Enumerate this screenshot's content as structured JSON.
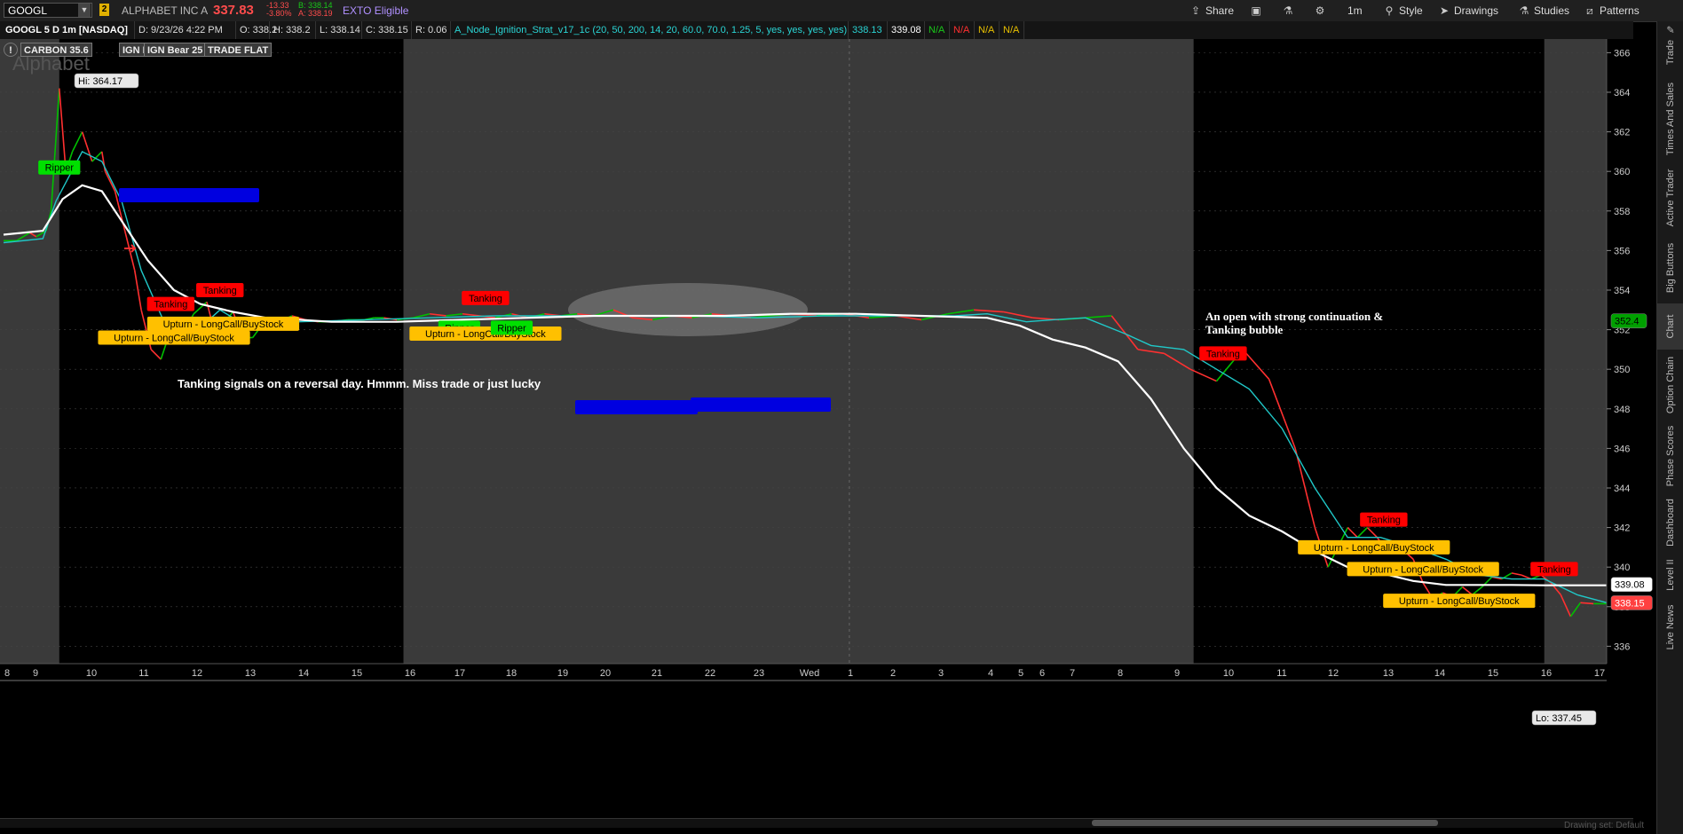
{
  "toolbar": {
    "symbol": "GOOGL",
    "link_group": "2",
    "company": "ALPHABET INC A",
    "last": "337.83",
    "net_change": "-13.33",
    "pct_change": "-3.80%",
    "bid": "B: 338.14",
    "ask": "A: 338.19",
    "exto": "EXTO Eligible",
    "buttons": {
      "share": "Share",
      "style": "Style",
      "drawings": "Drawings",
      "studies": "Studies",
      "patterns": "Patterns",
      "interval": "1m"
    }
  },
  "status": {
    "symbol_desc": "GOOGL 5 D 1m [NASDAQ]",
    "date": "D: 9/23/26 4:22 PM",
    "open": "O: 338.2",
    "high": "H: 338.2",
    "low": "L: 338.14",
    "close": "C: 338.15",
    "range": "R: 0.06",
    "study": "A_Node_Ignition_Strat_v17_1c (20, 50, 200, 14, 20, 60.0, 70.0, 1.25, 5, yes, yes, yes, yes)",
    "v1": "338.13",
    "v2": "339.08",
    "na1": "N/A",
    "na2": "N/A",
    "na3": "N/A",
    "na4": "N/A"
  },
  "indicator_badges": [
    "CARBON 35.6",
    "IGN Bull 0",
    "IGN Bear 25",
    "TRADE FLAT"
  ],
  "watermark": "Alphabet",
  "side_tabs": [
    "Trade",
    "Times And Sales",
    "Active Trader",
    "Big Buttons",
    "Chart",
    "Option Chain",
    "Phase Scores",
    "Dashboard",
    "Level II",
    "Live News"
  ],
  "drawing_set": "Drawing set: Default",
  "colors": {
    "bull": "#00c000",
    "bear": "#ff3030",
    "ma_long": "#ffffff",
    "ma_short": "#20c8c8",
    "session_bg": "#3a3a3a",
    "ext_bg": "#000000",
    "tag_tanking": "#ff0000",
    "tag_upturn": "#ffc000",
    "tag_ripper": "#00e000",
    "tag_blue": "#0000e0"
  },
  "chart_data": {
    "type": "line",
    "symbol": "GOOGL",
    "interval": "1m",
    "period": "5 D",
    "y_axis_ticks": [
      336,
      338,
      340,
      342,
      344,
      346,
      348,
      350,
      352,
      354,
      356,
      358,
      360,
      362,
      364,
      366
    ],
    "ylim": [
      335.3,
      366.6
    ],
    "x_ticks": [
      "8",
      "9",
      "10",
      "11",
      "12",
      "13",
      "14",
      "15",
      "16",
      "17",
      "18",
      "19",
      "20",
      "21",
      "22",
      "23",
      "Wed",
      "1",
      "2",
      "3",
      "4",
      "5",
      "6",
      "7",
      "8",
      "9",
      "10",
      "11",
      "12",
      "13",
      "14",
      "15",
      "16",
      "17"
    ],
    "price_labels": {
      "current": "338.15",
      "ma_value": "339.08",
      "other": "352.4",
      "high": "Hi: 364.17",
      "low": "Lo: 337.45"
    },
    "series": [
      {
        "name": "Price",
        "x": [
          0,
          4,
          8,
          10,
          13,
          14.5,
          17,
          19,
          21,
          24,
          27,
          30,
          31,
          34,
          37,
          40,
          42,
          45,
          48,
          51,
          54,
          58,
          62,
          64,
          67,
          70,
          73,
          76,
          80,
          84,
          88,
          92,
          96,
          100,
          105,
          110,
          113,
          116,
          120,
          125,
          130,
          135,
          140,
          145,
          150,
          155,
          160,
          165,
          170,
          175,
          180,
          186,
          192,
          198,
          204,
          210,
          216,
          222,
          228,
          234,
          240,
          248,
          256,
          264,
          272,
          280,
          288,
          296,
          305,
          314,
          322,
          330,
          338,
          346,
          354,
          362,
          370,
          378,
          386,
          394,
          400,
          404,
          407,
          410,
          413,
          416,
          419,
          422,
          426,
          430,
          433,
          436,
          439,
          442,
          445,
          448,
          451,
          454,
          457,
          460,
          463,
          466,
          469,
          472,
          475,
          478,
          481,
          485,
          489
        ],
        "y": [
          356.5,
          356.5,
          356.9,
          356.7,
          357,
          358,
          364.2,
          360,
          361,
          362,
          360.5,
          361,
          360,
          359,
          357,
          355,
          353,
          351,
          350.5,
          352,
          351.6,
          352.8,
          353.4,
          352.1,
          352.3,
          352.9,
          351.6,
          351.6,
          352.5,
          352.4,
          352.7,
          352.5,
          352.4,
          352.4,
          352.5,
          352.5,
          352.6,
          352.6,
          352.5,
          352.6,
          352.8,
          352.7,
          352.8,
          352.7,
          352.6,
          352.8,
          352.6,
          352.8,
          352.7,
          352.8,
          352.7,
          353,
          352.6,
          352.5,
          352.7,
          352.6,
          352.8,
          352.7,
          352.6,
          352.7,
          352.8,
          352.7,
          352.8,
          352.6,
          352.7,
          352.5,
          352.8,
          353,
          352.9,
          352.6,
          352.5,
          352.6,
          352.7,
          351,
          350.8,
          350,
          349.4,
          351,
          349.5,
          346,
          342,
          340,
          341,
          342,
          341.5,
          342,
          341.5,
          340.8,
          341,
          340.4,
          339.2,
          338.4,
          338.7,
          338.5,
          339,
          338.6,
          339,
          339.5,
          339.4,
          339.7,
          339.6,
          339.4,
          339.6,
          339.2,
          338.6,
          337.5,
          338.2,
          338.15,
          338.15
        ]
      },
      {
        "name": "EMA",
        "x": [
          0,
          12,
          16,
          24,
          30,
          36,
          42,
          50,
          58,
          66,
          74,
          90,
          110,
          130,
          150,
          170,
          190,
          210,
          230,
          250,
          270,
          290,
          300,
          306,
          312,
          320,
          330,
          342,
          350,
          360,
          370,
          380,
          390,
          400,
          410,
          420,
          430,
          440,
          450,
          460,
          470,
          480,
          489
        ],
        "y": [
          356.4,
          356.6,
          358.5,
          361,
          360.5,
          358.5,
          355,
          352,
          351.8,
          353,
          352.2,
          352.4,
          352.5,
          352.6,
          352.7,
          352.7,
          352.7,
          352.7,
          352.6,
          352.7,
          352.7,
          352.7,
          352.8,
          352.6,
          352.4,
          352.5,
          352.6,
          351.8,
          351.2,
          351,
          350,
          349,
          347,
          344,
          341.5,
          341.5,
          341,
          340.4,
          339.6,
          339.4,
          339.4,
          338.6,
          338.2
        ]
      },
      {
        "name": "MA200",
        "x": [
          0,
          12,
          18,
          24,
          30,
          36,
          44,
          52,
          60,
          70,
          80,
          90,
          100,
          120,
          140,
          160,
          180,
          200,
          220,
          240,
          260,
          280,
          300,
          310,
          320,
          330,
          340,
          350,
          360,
          370,
          380,
          390,
          400,
          410,
          420,
          430,
          440,
          450,
          460,
          470,
          480,
          489
        ],
        "y": [
          356.8,
          357,
          358.6,
          359.3,
          359,
          357.5,
          355.5,
          354,
          353.3,
          352.9,
          352.6,
          352.5,
          352.4,
          352.4,
          352.5,
          352.6,
          352.7,
          352.7,
          352.7,
          352.8,
          352.8,
          352.7,
          352.6,
          352.2,
          351.5,
          351.1,
          350.4,
          348.5,
          346,
          344,
          342.6,
          341.8,
          340.8,
          340,
          339.7,
          339.3,
          339.1,
          339.1,
          339.1,
          339.08,
          339.08,
          339.08
        ]
      }
    ],
    "signals": [
      {
        "label": "Ripper",
        "type": "ripper",
        "x": 17,
        "y": 360.2
      },
      {
        "label": "Tanking",
        "type": "tanking",
        "x": 51,
        "y": 353.3
      },
      {
        "label": "Tanking",
        "type": "tanking",
        "x": 66,
        "y": 354
      },
      {
        "label": "Upturn - LongCall/BuyStock",
        "type": "upturn",
        "x": 52,
        "y": 351.6
      },
      {
        "label": "Upturn - LongCall/BuyStock",
        "type": "upturn",
        "x": 67,
        "y": 352.3
      },
      {
        "label": "Ripper",
        "type": "ripper",
        "x": 139,
        "y": 352.1
      },
      {
        "label": "Tanking",
        "type": "tanking",
        "x": 147,
        "y": 353.6
      },
      {
        "label": "Upturn - LongCall/BuyStock",
        "type": "upturn",
        "x": 147,
        "y": 351.8
      },
      {
        "label": "Ripper",
        "type": "ripper",
        "x": 155,
        "y": 352.1
      },
      {
        "label": "Tanking",
        "type": "tanking",
        "x": 372,
        "y": 350.8
      },
      {
        "label": "Tanking",
        "type": "tanking",
        "x": 421,
        "y": 342.4
      },
      {
        "label": "Upturn - LongCall/BuyStock",
        "type": "upturn",
        "x": 418,
        "y": 341
      },
      {
        "label": "Upturn - LongCall/BuyStock",
        "type": "upturn",
        "x": 433,
        "y": 339.9
      },
      {
        "label": "Upturn - LongCall/BuyStock",
        "type": "upturn",
        "x": 444,
        "y": 338.3
      },
      {
        "label": "Tanking",
        "type": "tanking",
        "x": 473,
        "y": 339.9
      }
    ],
    "annotations": [
      "Tanking signals on a reversal day.  Hmmm.  Miss trade or just lucky",
      "An open with strong continuation & Tanking bubble"
    ]
  }
}
